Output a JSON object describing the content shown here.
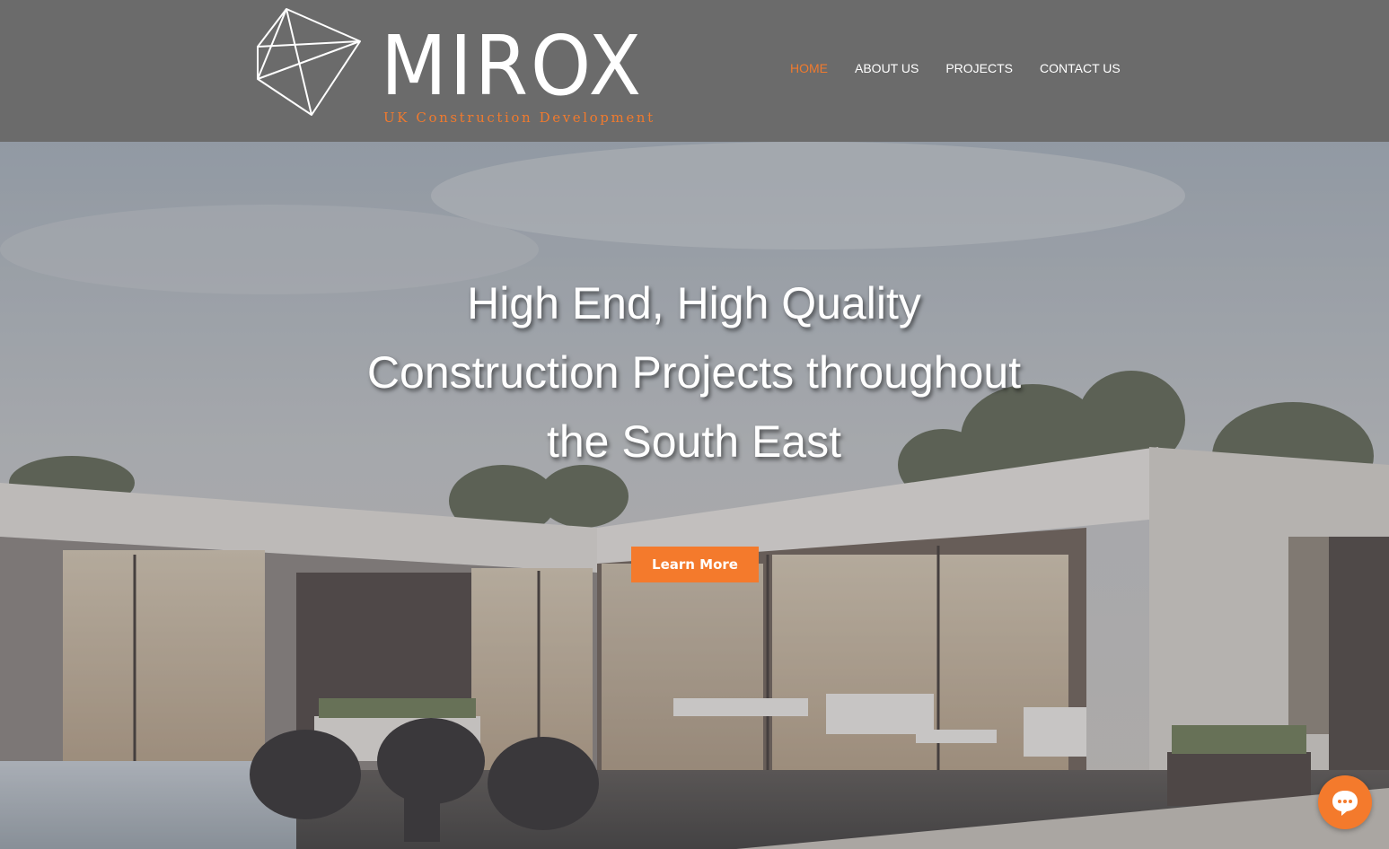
{
  "brand": {
    "name": "MIROX",
    "tagline": "UK Construction Development",
    "accent_color": "#f47a2c",
    "header_color": "#6b6b6b"
  },
  "nav": {
    "items": [
      {
        "label": "HOME",
        "active": true
      },
      {
        "label": "ABOUT US",
        "active": false
      },
      {
        "label": "PROJECTS",
        "active": false
      },
      {
        "label": "CONTACT US",
        "active": false
      }
    ]
  },
  "hero": {
    "heading_lines": [
      "High End, High Quality",
      "Construction Projects throughout",
      "the South East"
    ],
    "cta_label": "Learn More",
    "background_image": "modern-house-with-patio"
  },
  "chat": {
    "icon": "chat-bubble-icon"
  }
}
